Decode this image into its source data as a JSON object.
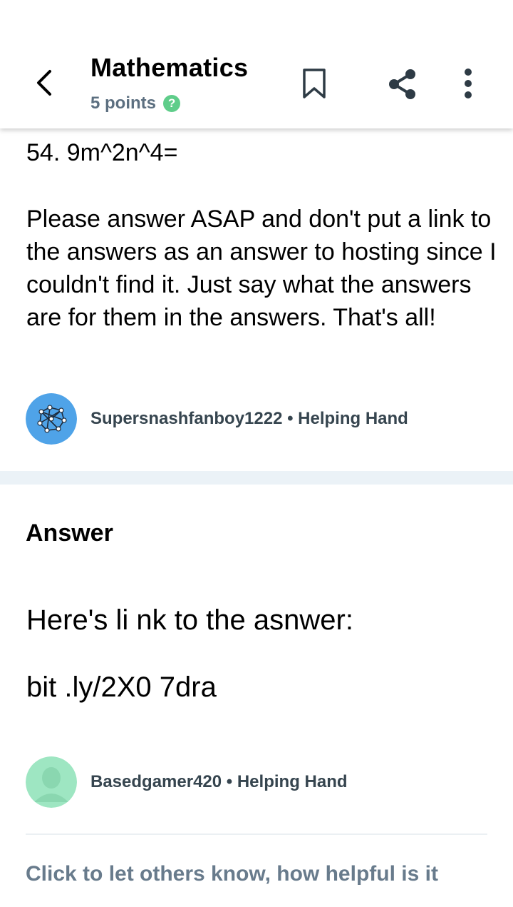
{
  "header": {
    "title": "Mathematics",
    "points": "5 points",
    "help_badge": "?",
    "icons": [
      "back-arrow-icon",
      "bookmark-icon",
      "share-icon",
      "more-vertical-icon"
    ]
  },
  "question": {
    "first_line": "54. 9m^2n^4=",
    "body": "Please answer ASAP and don't put a link to the answers as an answer to hosting since I couldn't find it. Just say what the answers are for them in the answers. That's all!",
    "author": "Supersnashfanboy1222 • Helping Hand"
  },
  "answer": {
    "heading": "Answer",
    "line1": "Here's li nk to the asnwer:",
    "line2": "bit .ly/2X0 7dra",
    "author": "Basedgamer420 • Helping Hand"
  },
  "footer": {
    "rate_prompt": "Click to let others know, how helpful is it"
  },
  "colors": {
    "muted_text": "#5c6f80",
    "help_green": "#5fcd8a",
    "divider": "#ebf2f7",
    "avatar_blue": "#4fa3e8",
    "avatar_green": "#9ee6c2"
  }
}
